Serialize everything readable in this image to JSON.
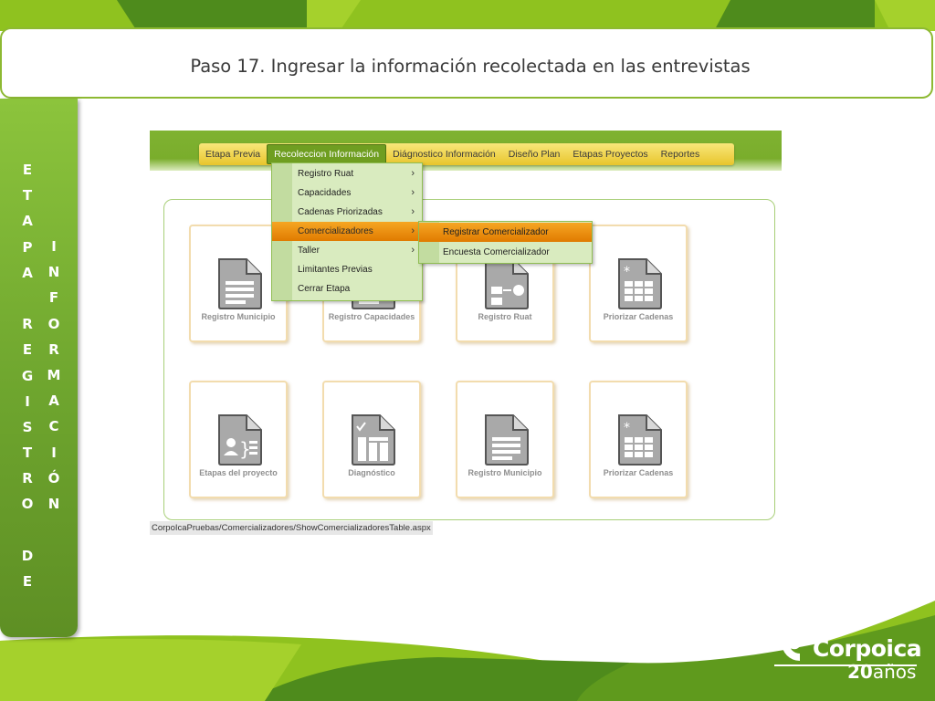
{
  "slide": {
    "title": "Paso 17. Ingresar la información recolectada en las entrevistas",
    "side_col1": [
      "E",
      "T",
      "A",
      "P",
      "A",
      "",
      "R",
      "E",
      "G",
      "I",
      "S",
      "T",
      "R",
      "O",
      "",
      "D",
      "E"
    ],
    "side_col2": [
      "I",
      "N",
      "F",
      "O",
      "R",
      "M",
      "A",
      "C",
      "I",
      "Ó",
      "N"
    ]
  },
  "nav": {
    "items": [
      "Etapa Previa",
      "Recoleccion Información",
      "Diágnostico Información",
      "Diseño Plan",
      "Etapas Proyectos",
      "Reportes"
    ],
    "active_index": 1
  },
  "dropdown": {
    "items": [
      {
        "label": "Registro Ruat",
        "arrow": "›"
      },
      {
        "label": "Capacidades",
        "arrow": "›"
      },
      {
        "label": "Cadenas Priorizadas",
        "arrow": "›"
      },
      {
        "label": "Comercializadores",
        "arrow": "›"
      },
      {
        "label": "Taller",
        "arrow": "›"
      },
      {
        "label": "Limitantes Previas",
        "arrow": ""
      },
      {
        "label": "Cerrar Etapa",
        "arrow": ""
      }
    ],
    "highlighted_index": 3
  },
  "submenu": {
    "items": [
      "Registrar Comercializador",
      "Encuesta Comercializador"
    ],
    "highlighted_index": 0
  },
  "tiles": [
    {
      "label": "Registro Municipio",
      "icon": "document-lines-icon"
    },
    {
      "label": "Registro Capacidades",
      "icon": "document-lines-icon"
    },
    {
      "label": "Registro Ruat",
      "icon": "flowchart-document-icon"
    },
    {
      "label": "Priorizar Cadenas",
      "icon": "grid-star-document-icon"
    },
    {
      "label": "Etapas del proyecto",
      "icon": "person-braces-document-icon"
    },
    {
      "label": "Diagnóstico",
      "icon": "checklist-chart-document-icon"
    },
    {
      "label": "Registro Municipio",
      "icon": "document-lines-icon"
    },
    {
      "label": "Priorizar Cadenas",
      "icon": "grid-star-document-icon"
    }
  ],
  "status_url": "CorpoIcaPruebas/Comercializadores/ShowComercializadoresTable.aspx",
  "logo": {
    "name": "Corpoica",
    "years_num": "20",
    "years_text": "años"
  },
  "colors": {
    "brand_green": "#8db932",
    "dark_green": "#5e8f24",
    "nav_yellow": "#e8c52c",
    "highlight_orange": "#f39a17"
  }
}
